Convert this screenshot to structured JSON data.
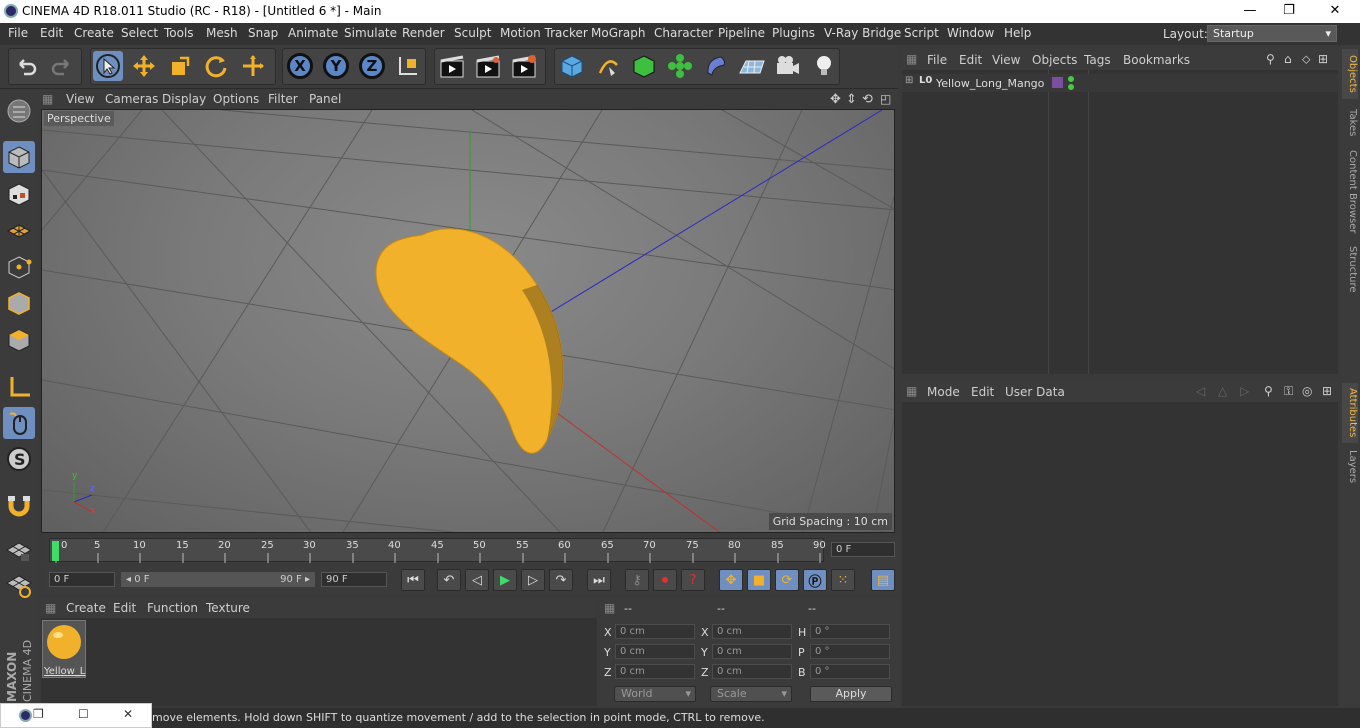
{
  "window": {
    "title": "CINEMA 4D R18.011 Studio (RC - R18) - [Untitled 6 *] - Main",
    "minimize": "—",
    "restore": "❐",
    "close": "✕"
  },
  "menubar": {
    "items": [
      "File",
      "Edit",
      "Create",
      "Select",
      "Tools",
      "Mesh",
      "Snap",
      "Animate",
      "Simulate",
      "Render",
      "Sculpt",
      "Motion Tracker",
      "MoGraph",
      "Character",
      "Pipeline",
      "Plugins",
      "V-Ray Bridge",
      "Script",
      "Window",
      "Help"
    ],
    "layout_label": "Layout:",
    "layout_value": "Startup"
  },
  "toolbar": {
    "axis_x": "X",
    "axis_y": "Y",
    "axis_z": "Z"
  },
  "viewport": {
    "menu": [
      "View",
      "Cameras",
      "Display",
      "Options",
      "Filter",
      "Panel"
    ],
    "camera": "Perspective",
    "grid_spacing": "Grid Spacing : 10 cm",
    "axis_y": "y",
    "axis_z": "z",
    "axis_x": "x",
    "colors": {
      "mango": "#f2b12a",
      "x_axis": "#c0302a",
      "y_axis": "#2da12d",
      "z_axis": "#2a2ac0"
    }
  },
  "timeline": {
    "ticks": [
      "0",
      "5",
      "10",
      "15",
      "20",
      "25",
      "30",
      "35",
      "40",
      "45",
      "50",
      "55",
      "60",
      "65",
      "70",
      "75",
      "80",
      "85",
      "90"
    ],
    "current_frame": "0 F"
  },
  "playback": {
    "start_field": "0 F",
    "range_start": "◂ 0 F",
    "range_end": "90 F ▸",
    "end_field": "90 F"
  },
  "material_manager": {
    "menu": [
      "Create",
      "Edit",
      "Function",
      "Texture"
    ],
    "material_name": "Yellow_L"
  },
  "coordinates": {
    "headers": [
      "--",
      "--",
      "--"
    ],
    "rows": [
      {
        "l1": "X",
        "v1": "0 cm",
        "l2": "X",
        "v2": "0 cm",
        "l3": "H",
        "v3": "0 °"
      },
      {
        "l1": "Y",
        "v1": "0 cm",
        "l2": "Y",
        "v2": "0 cm",
        "l3": "P",
        "v3": "0 °"
      },
      {
        "l1": "Z",
        "v1": "0 cm",
        "l2": "Z",
        "v2": "0 cm",
        "l3": "B",
        "v3": "0 °"
      }
    ],
    "space_select": "World",
    "mode_select": "Scale",
    "apply_label": "Apply"
  },
  "objects_panel": {
    "menu": [
      "File",
      "Edit",
      "View",
      "Objects",
      "Tags",
      "Bookmarks"
    ],
    "object_name": "Yellow_Long_Mango"
  },
  "attributes_panel": {
    "menu": [
      "Mode",
      "Edit",
      "User Data"
    ]
  },
  "side_tabs": {
    "upper": [
      "Objects",
      "Takes",
      "Content Browser",
      "Structure"
    ],
    "lower": [
      "Attributes",
      "Layers"
    ]
  },
  "branding": {
    "maxon": "MAXON",
    "cinema": "CINEMA 4D"
  },
  "status": {
    "text": "move elements. Hold down SHIFT to quantize movement / add to the selection in point mode, CTRL to remove."
  }
}
